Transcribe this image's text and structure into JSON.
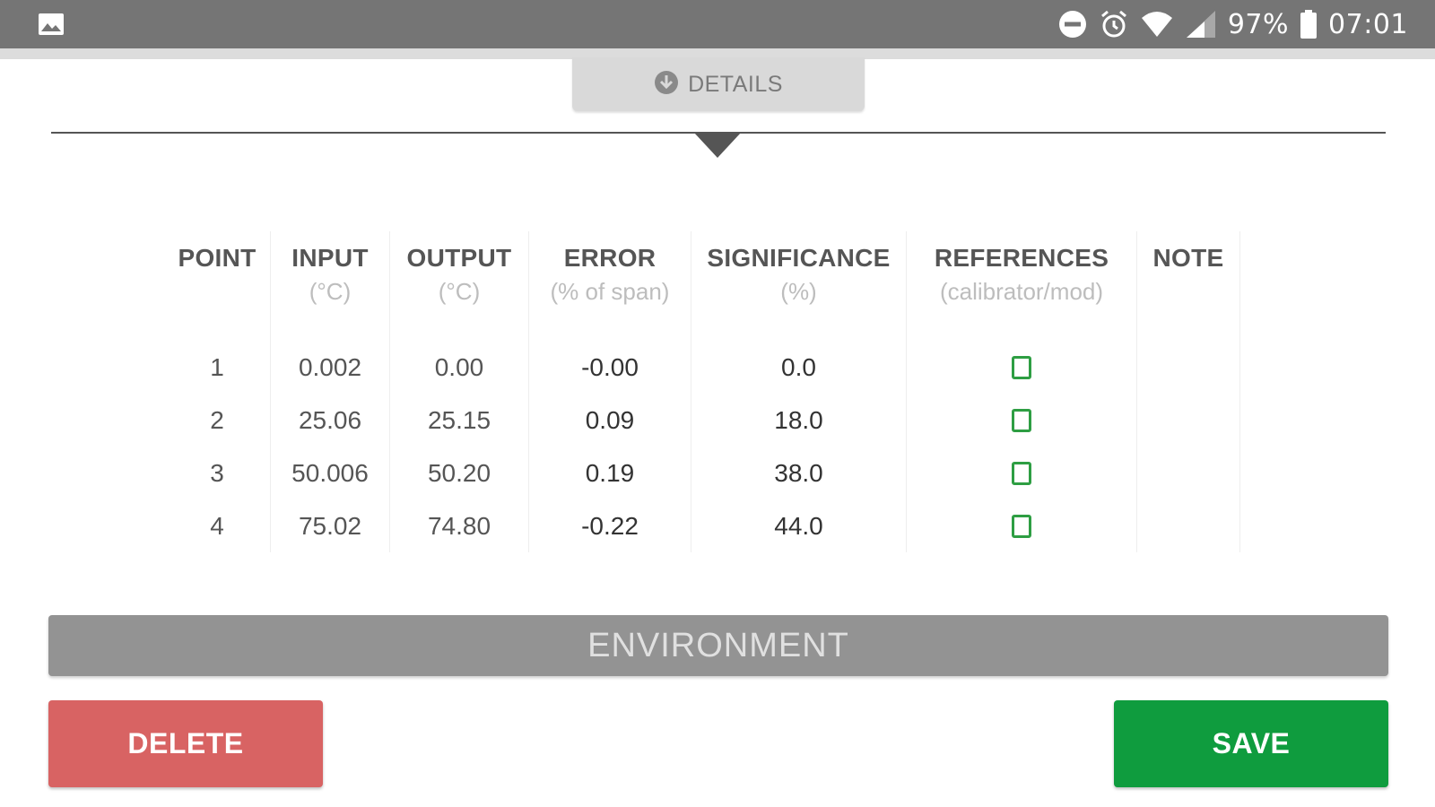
{
  "status_bar": {
    "battery_percent": "97%",
    "time": "07:01",
    "icons": [
      "image-icon",
      "do-not-disturb-icon",
      "alarm-icon",
      "wifi-icon",
      "cell-signal-icon",
      "battery-icon"
    ]
  },
  "details_tab": {
    "label": "DETAILS",
    "icon": "arrow-down-circle-icon"
  },
  "table": {
    "columns": [
      {
        "key": "point",
        "label": "POINT",
        "unit": ""
      },
      {
        "key": "input",
        "label": "INPUT",
        "unit": "(°C)"
      },
      {
        "key": "output",
        "label": "OUTPUT",
        "unit": "(°C)"
      },
      {
        "key": "error",
        "label": "ERROR",
        "unit": "(% of span)"
      },
      {
        "key": "significance",
        "label": "SIGNIFICANCE",
        "unit": "(%)"
      },
      {
        "key": "references",
        "label": "REFERENCES",
        "unit": "(calibrator/mod)"
      },
      {
        "key": "note",
        "label": "NOTE",
        "unit": ""
      }
    ],
    "rows": [
      {
        "point": "1",
        "input": "0.002",
        "output": "0.00",
        "error": "-0.00",
        "significance": "0.0",
        "note": ""
      },
      {
        "point": "2",
        "input": "25.06",
        "output": "25.15",
        "error": "0.09",
        "significance": "18.0",
        "note": ""
      },
      {
        "point": "3",
        "input": "50.006",
        "output": "50.20",
        "error": "0.19",
        "significance": "38.0",
        "note": ""
      },
      {
        "point": "4",
        "input": "75.02",
        "output": "74.80",
        "error": "-0.22",
        "significance": "44.0",
        "note": ""
      }
    ]
  },
  "environment": {
    "label": "ENVIRONMENT"
  },
  "buttons": {
    "delete_label": "DELETE",
    "save_label": "SAVE"
  },
  "colors": {
    "status_bar": "#757575",
    "delete": "#d86363",
    "save": "#0f9c3e",
    "reference_icon": "#2e9e43",
    "environment_bar": "#939393"
  }
}
